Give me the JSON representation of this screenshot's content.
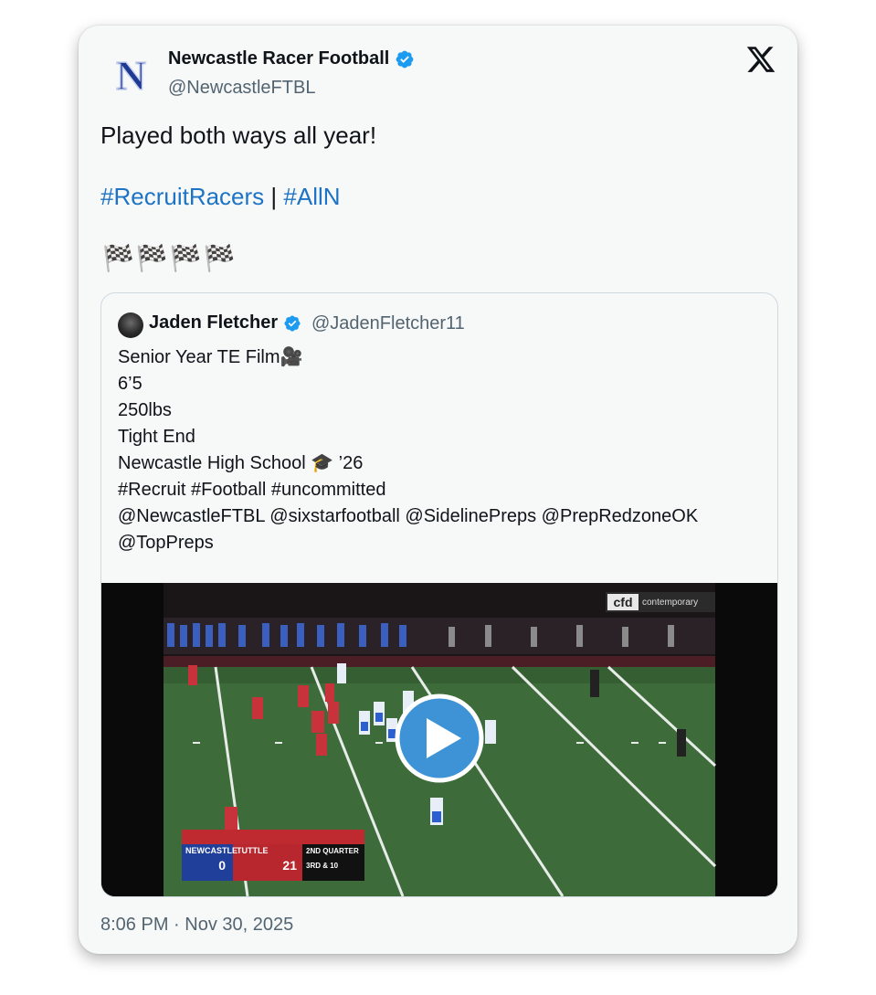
{
  "tweet": {
    "author": {
      "name": "Newcastle Racer Football",
      "handle": "@NewcastleFTBL",
      "avatar_letter": "N"
    },
    "text": "Played both ways all year!",
    "hashtags": [
      "#RecruitRacers",
      "#AllN"
    ],
    "hashtag_separator": "|",
    "emoji_line": "🏁🏁🏁🏁",
    "timestamp": "8:06 PM · Nov 30, 2025"
  },
  "quoted_tweet": {
    "author": {
      "name": "Jaden Fletcher",
      "handle": "@JadenFletcher11"
    },
    "lines": [
      "Senior Year TE Film🎥",
      "6’5",
      "250lbs",
      "Tight End",
      "Newcastle High School 🎓 ’26",
      "#Recruit #Football #uncommitted",
      "@NewcastleFTBL @sixstarfootball @SidelinePreps @PrepRedzoneOK",
      "@TopPreps"
    ]
  },
  "video": {
    "banner_logo": "cfd",
    "banner_text": "contemporary",
    "scoreboard": {
      "home_team": "NEWCASTLE",
      "home_score": "0",
      "away_team": "TUTTLE",
      "away_score": "21",
      "quarter": "2ND QUARTER",
      "down": "3RD & 10"
    }
  },
  "icons": {
    "x_logo": "x-logo-icon",
    "verified": "verified-badge-icon",
    "play": "play-icon"
  },
  "colors": {
    "accent_link": "#1d73c4",
    "verified": "#1d9bf0",
    "play_button": "#3d93d6"
  }
}
